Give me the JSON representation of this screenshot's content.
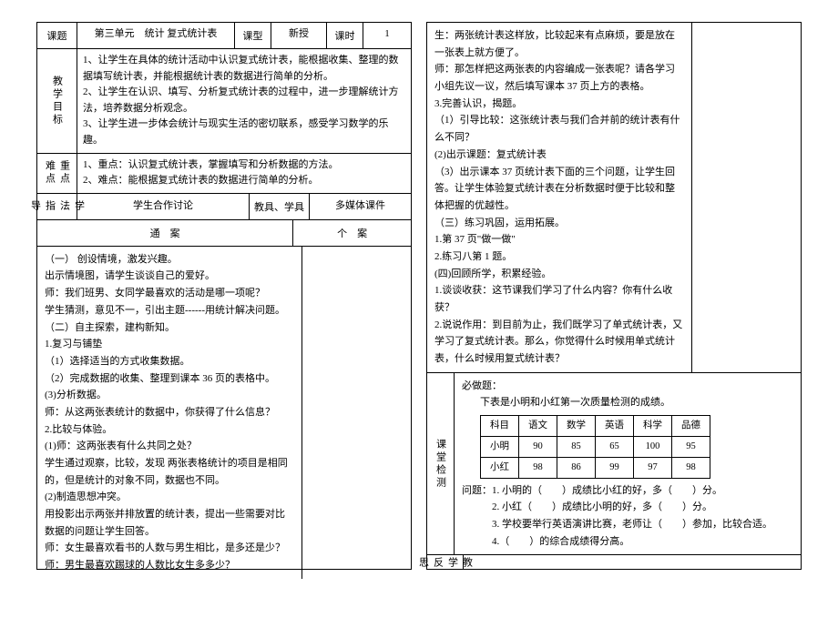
{
  "header": {
    "topic_label": "课题",
    "topic_value": "第三单元　统计 复式统计表",
    "type_label": "课型",
    "type_value": "新授",
    "period_label": "课时",
    "period_value": "1"
  },
  "objectives": {
    "label": "教学目标",
    "items": [
      "1、让学生在具体的统计活动中认识复式统计表，能根据收集、整理的数据填写统计表，并能根据统计表的数据进行简单的分析。",
      "2、让学生在认识、填写、分析复式统计表的过程中，进一步理解统计方法，培养数据分析观念。",
      "3、让学生进一步体会统计与现实生活的密切联系，感受学习数学的乐趣。"
    ]
  },
  "keypoints": {
    "label": "重点难点",
    "items": [
      "1、重点：认识复式统计表，掌握填写和分析数据的方法。",
      "2、难点：能根据复式统计表的数据进行简单的分析。"
    ]
  },
  "method": {
    "label": "学法指导",
    "value": "学生合作讨论",
    "tools_label": "教具、学具",
    "tools_value": "多媒体课件"
  },
  "plan": {
    "main_label": "通　案",
    "case_label": "个　案"
  },
  "content_left": {
    "lines": [
      "（一）  创设情境，激发兴趣。",
      "出示情境图，请学生谈谈自己的爱好。",
      "师：我们班男、女同学最喜欢的活动是哪一项呢？",
      "学生猜测，意见不一，引出主题------用统计解决问题。",
      "（二）自主探索，建构新知。",
      "1.复习与铺垫",
      "（1）选择适当的方式收集数据。",
      "（2）完成数据的收集、整理到课本 36 页的表格中。",
      "(3)分析数据。",
      "师：从这两张表统计的数据中，你获得了什么信息？",
      "2.比较与体验。",
      "(1)师：这两张表有什么共同之处？",
      "学生通过观察，比较，发现  两张表格统计的项目是相同的，但是统计的对象不同，数据也不同。",
      "(2)制造思想冲突。",
      "用投影出示两张并排放置的统计表，提出一些需要对比数据的问题让学生回答。",
      "师：女生最喜欢看书的人数与男生相比，是多还是少？",
      "师：男生最喜欢踢球的人数比女生多多少？"
    ]
  },
  "content_right_top": {
    "lines": [
      "生：两张统计表这样放，比较起来有点麻烦，要是放在一张表上就方便了。",
      "师：那怎样把这两张表的内容编成一张表呢？请各学习小组先议一议，然后填写课本 37 页上方的表格。",
      "3.完善认识，揭题。",
      "（1）引导比较：这张统计表与我们合并前的统计表有什么不同？",
      "(2)出示课题：复式统计表",
      "（3）出示课本 37 页统计表下面的三个问题，让学生回答。让学生体验复式统计表在分析数据时便于比较和整体把握的优越性。",
      "（三）练习巩固，运用拓展。",
      "1.第 37 页\"做一做\"",
      "2.练习八第 1 题。",
      "(四)回顾所学，积累经验。",
      "1.谈谈收获：这节课我们学习了什么内容？你有什么收获？",
      "2.说说作用：到目前为止，我们既学习了单式统计表，又学习了复式统计表。那么，你觉得什么时候用单式统计表，什么时候用复式统计表？"
    ]
  },
  "check": {
    "label": "课堂检测",
    "heading": "必做题：",
    "subheading": "下表是小明和小红第一次质量检测的成绩。",
    "table": {
      "headers": [
        "科目",
        "语文",
        "数学",
        "英语",
        "科学",
        "品德"
      ],
      "rows": [
        {
          "name": "小明",
          "values": [
            "90",
            "85",
            "65",
            "100",
            "95"
          ]
        },
        {
          "name": "小红",
          "values": [
            "98",
            "86",
            "99",
            "97",
            "98"
          ]
        }
      ]
    },
    "questions": [
      "问题：1. 小明的（　　）成绩比小红的好，多（　　）分。",
      "　　　2. 小红（　　）成绩比小明的好，多（　　）分。",
      "　　　3. 学校要举行英语演讲比赛，老师让（　　）参加，比较合适。",
      "　　　4.（　　）的综合成绩得分高。"
    ]
  },
  "reflect": {
    "label": "教学反思"
  }
}
